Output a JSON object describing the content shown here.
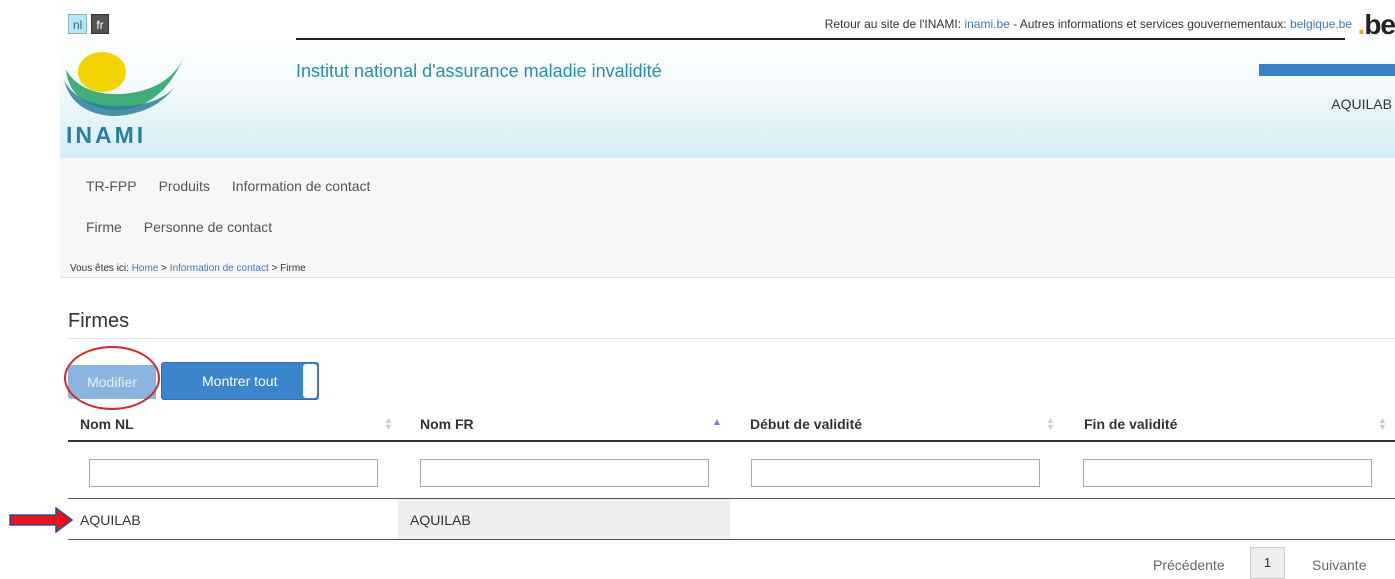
{
  "lang": {
    "nl": "nl",
    "fr": "fr"
  },
  "top_bar": {
    "prefix": "Retour au site de l'INAMI: ",
    "inami_link": "inami.be",
    "middle": " - Autres informations et services gouvernementaux: ",
    "belgique_link": "belgique.be",
    "be_logo": "be",
    "be_dot": "."
  },
  "header": {
    "logo_text": "INAMI",
    "institute_name": "Institut national d'assurance maladie invalidité",
    "company": "AQUILAB"
  },
  "nav": {
    "primary": [
      "TR-FPP",
      "Produits",
      "Information de contact"
    ],
    "secondary": [
      "Firme",
      "Personne de contact"
    ]
  },
  "breadcrumb": {
    "prefix": "Vous êtes ici: ",
    "home": "Home",
    "sep1": " > ",
    "contact": "Information de contact",
    "sep2": " > ",
    "current": "Firme"
  },
  "page": {
    "title": "Firmes"
  },
  "toolbar": {
    "modifier": "Modifier",
    "montrer_tout": "Montrer tout"
  },
  "table": {
    "columns": [
      "Nom NL",
      "Nom FR",
      "Début de validité",
      "Fin de validité"
    ],
    "rows": [
      [
        "AQUILAB",
        "AQUILAB",
        "",
        ""
      ]
    ]
  },
  "pagination": {
    "previous": "Précédente",
    "page": "1",
    "next": "Suivante"
  },
  "colors": {
    "accent": "#3b85cc",
    "annotation": "#d42a2a",
    "brand": "#2a7f9b"
  }
}
